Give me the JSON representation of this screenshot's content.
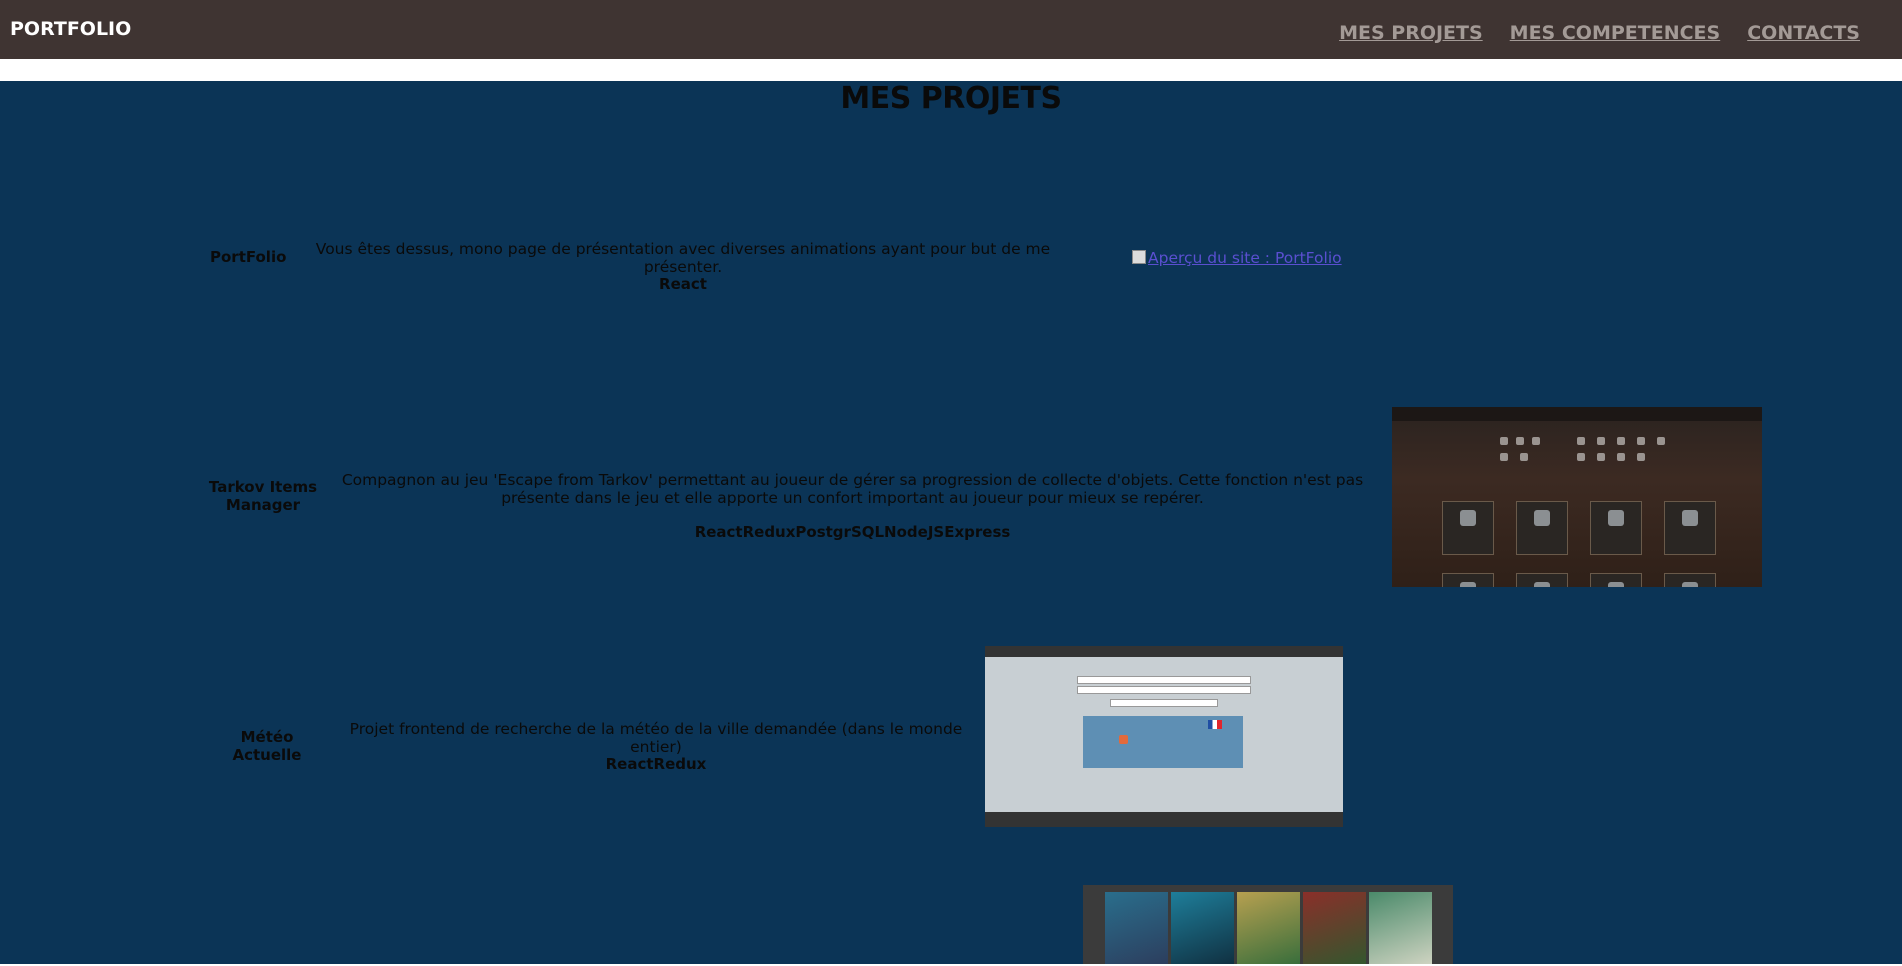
{
  "header": {
    "brand": "PORTFOLIO",
    "nav": [
      "MES PROJETS",
      "MES COMPETENCES",
      "CONTACTS"
    ]
  },
  "main": {
    "title": "MES PROJETS",
    "projects": [
      {
        "name": "PortFolio",
        "description": "Vous êtes dessus, mono page de présentation avec diverses animations ayant pour but de me présenter.",
        "tech": "React",
        "image_alt": "Aperçu du site : PortFolio"
      },
      {
        "name": "Tarkov Items Manager",
        "description": "Compagnon au jeu 'Escape from Tarkov' permettant au joueur de gérer sa progression de collecte d'objets. Cette fonction n'est pas présente dans le jeu et elle apporte un confort important au joueur pour mieux se repérer.",
        "tech": "ReactReduxPostgrSQLNodeJSExpress"
      },
      {
        "name": "Météo Actuelle",
        "description": "Projet frontend de recherche de la météo de la ville demandée (dans le monde entier)",
        "tech": "ReactRedux"
      }
    ]
  },
  "colors": {
    "header_bg": "#3f3432",
    "main_bg": "#0b3456",
    "nav_link": "#a39a96"
  }
}
